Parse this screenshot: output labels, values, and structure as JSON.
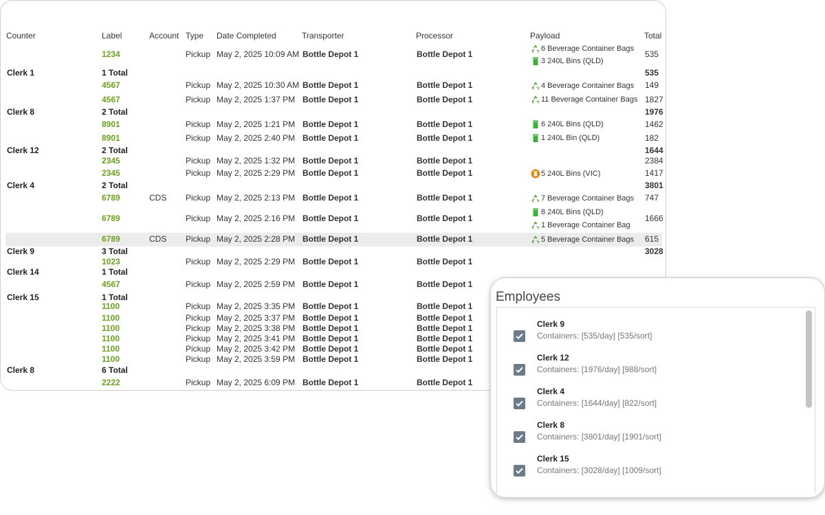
{
  "headers": {
    "counter": "Counter",
    "label": "Label",
    "account": "Account",
    "type": "Type",
    "date": "Date Completed",
    "transporter": "Transporter",
    "processor": "Processor",
    "payload": "Payload",
    "total": "Total"
  },
  "rows": [
    {
      "label": "1234",
      "account": "",
      "type": "Pickup",
      "date": "May 2, 2025 10:09 AM",
      "transporter": "Bottle Depot 1",
      "processor": "Bottle Depot 1",
      "total": "535"
    },
    {
      "label": "4567",
      "account": "",
      "type": "Pickup",
      "date": "May 2, 2025 10:30 AM",
      "transporter": "Bottle Depot 1",
      "processor": "Bottle Depot 1",
      "total": "149"
    },
    {
      "label": "4567",
      "account": "",
      "type": "Pickup",
      "date": "May 2, 2025 1:37 PM",
      "transporter": "Bottle Depot 1",
      "processor": "Bottle Depot 1",
      "total": "1827"
    },
    {
      "label": "8901",
      "account": "",
      "type": "Pickup",
      "date": "May 2, 2025 1:21 PM",
      "transporter": "Bottle Depot 1",
      "processor": "Bottle Depot 1",
      "total": "1462"
    },
    {
      "label": "8901",
      "account": "",
      "type": "Pickup",
      "date": "May 2, 2025 2:40 PM",
      "transporter": "Bottle Depot 1",
      "processor": "Bottle Depot 1",
      "total": "182"
    },
    {
      "label": "2345",
      "account": "",
      "type": "Pickup",
      "date": "May 2, 2025 1:32 PM",
      "transporter": "Bottle Depot 1",
      "processor": "Bottle Depot 1",
      "total": "2384"
    },
    {
      "label": "2345",
      "account": "",
      "type": "Pickup",
      "date": "May 2, 2025 2:29 PM",
      "transporter": "Bottle Depot 1",
      "processor": "Bottle Depot 1",
      "total": "1417"
    },
    {
      "label": "6789",
      "account": "CDS",
      "type": "Pickup",
      "date": "May 2, 2025 2:13 PM",
      "transporter": "Bottle Depot 1",
      "processor": "Bottle Depot 1",
      "total": "747"
    },
    {
      "label": "6789",
      "account": "",
      "type": "Pickup",
      "date": "May 2, 2025 2:16 PM",
      "transporter": "Bottle Depot 1",
      "processor": "Bottle Depot 1",
      "total": "1666"
    },
    {
      "label": "6789",
      "account": "CDS",
      "type": "Pickup",
      "date": "May 2, 2025 2:28 PM",
      "transporter": "Bottle Depot 1",
      "processor": "Bottle Depot 1",
      "total": "615"
    },
    {
      "label": "1023",
      "account": "",
      "type": "Pickup",
      "date": "May 2, 2025 2:29 PM",
      "transporter": "Bottle Depot 1",
      "processor": "Bottle Depot 1",
      "total": ""
    },
    {
      "label": "4567",
      "account": "",
      "type": "Pickup",
      "date": "May 2, 2025 2:59 PM",
      "transporter": "Bottle Depot 1",
      "processor": "Bottle Depot 1",
      "total": ""
    },
    {
      "label": "1100",
      "account": "",
      "type": "Pickup",
      "date": "May 2, 2025 3:35 PM",
      "transporter": "Bottle Depot 1",
      "processor": "Bottle Depot 1",
      "total": ""
    },
    {
      "label": "1100",
      "account": "",
      "type": "Pickup",
      "date": "May 2, 2025 3:37 PM",
      "transporter": "Bottle Depot 1",
      "processor": "Bottle Depot 1",
      "total": ""
    },
    {
      "label": "1100",
      "account": "",
      "type": "Pickup",
      "date": "May 2, 2025 3:38 PM",
      "transporter": "Bottle Depot 1",
      "processor": "Bottle Depot 1",
      "total": ""
    },
    {
      "label": "1100",
      "account": "",
      "type": "Pickup",
      "date": "May 2, 2025 3:41 PM",
      "transporter": "Bottle Depot 1",
      "processor": "Bottle Depot 1",
      "total": ""
    },
    {
      "label": "1100",
      "account": "",
      "type": "Pickup",
      "date": "May 2, 2025 3:42 PM",
      "transporter": "Bottle Depot 1",
      "processor": "Bottle Depot 1",
      "total": ""
    },
    {
      "label": "1100",
      "account": "",
      "type": "Pickup",
      "date": "May 2, 2025 3:59 PM",
      "transporter": "Bottle Depot 1",
      "processor": "Bottle Depot 1",
      "total": ""
    },
    {
      "label": "2222",
      "account": "",
      "type": "Pickup",
      "date": "May 2, 2025 6:09 PM",
      "transporter": "Bottle Depot 1",
      "processor": "Bottle Depot 1",
      "total": ""
    }
  ],
  "groups": [
    {
      "counter": "Clerk 1",
      "label": "1 Total",
      "total": "535"
    },
    {
      "counter": "Clerk 8",
      "label": "2 Total",
      "total": "1976"
    },
    {
      "counter": "Clerk 12",
      "label": "2 Total",
      "total": "1644"
    },
    {
      "counter": "Clerk 4",
      "label": "2 Total",
      "total": "3801"
    },
    {
      "counter": "Clerk 9",
      "label": "3 Total",
      "total": "3028"
    },
    {
      "counter": "Clerk 14",
      "label": "1 Total",
      "total": ""
    },
    {
      "counter": "Clerk 15",
      "label": "1 Total",
      "total": ""
    },
    {
      "counter": "Clerk 8",
      "label": "6 Total",
      "total": ""
    }
  ],
  "payloads": [
    {
      "icon": "recycle-icon",
      "text": "6 Beverage Container Bags"
    },
    {
      "icon": "green-bin-icon",
      "text": "3 240L Bins (QLD)"
    },
    {
      "icon": "recycle-icon",
      "text": "4 Beverage Container Bags"
    },
    {
      "icon": "recycle-icon",
      "text": "11 Beverage Container Bags"
    },
    {
      "icon": "green-bin-icon",
      "text": "6 240L Bins (QLD)"
    },
    {
      "icon": "green-bin-icon",
      "text": "1 240L Bin (QLD)"
    },
    {
      "icon": "orange-bin-icon",
      "text": "5 240L Bins (VIC)"
    },
    {
      "icon": "recycle-icon",
      "text": "7 Beverage Container Bags"
    },
    {
      "icon": "green-bin-icon",
      "text": "8 240L Bins (QLD)"
    },
    {
      "icon": "recycle-icon",
      "text": "1 Beverage Container Bag"
    },
    {
      "icon": "recycle-icon",
      "text": "5 Beverage Container Bags"
    }
  ],
  "employees": {
    "title": "Employees",
    "items": [
      {
        "name": "Clerk 9",
        "containers": "Containers: [535/day] [535/sort]",
        "checked": true
      },
      {
        "name": "Clerk 12",
        "containers": "Containers: [1976/day] [988/sort]",
        "checked": true
      },
      {
        "name": "Clerk 4",
        "containers": "Containers: [1644/day] [822/sort]",
        "checked": true
      },
      {
        "name": "Clerk 8",
        "containers": "Containers: [3801/day] [1901/sort]",
        "checked": true
      },
      {
        "name": "Clerk 15",
        "containers": "Containers: [3028/day] [1009/sort]",
        "checked": true
      }
    ]
  },
  "colors": {
    "label_green": "#6aa01e",
    "recycle_green": "#4a9a2e",
    "bin_green": "#3fb13a",
    "bin_orange": "#e08a1e",
    "checkbox": "#6b7b88"
  }
}
